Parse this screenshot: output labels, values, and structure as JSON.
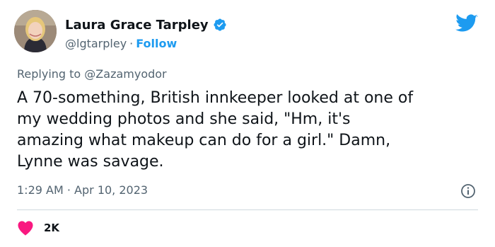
{
  "author": {
    "name": "Laura Grace Tarpley",
    "handle": "@lgtarpley",
    "separator": "·",
    "follow_label": "Follow"
  },
  "tweet": {
    "replying_prefix": "Replying to",
    "replying_to": "@Zazamyodor",
    "text_lines": [
      "A 70-something, British innkeeper looked at one of",
      "my wedding photos and she said, \"Hm, it's",
      "amazing what makeup can do for a girl.\" Damn,",
      "Lynne was savage."
    ],
    "time": "1:29 AM",
    "separator": "·",
    "date": "Apr 10, 2023",
    "like_count": "2K"
  },
  "icons": {
    "brand": "twitter-bird-icon",
    "verified": "verified-badge-icon",
    "info": "info-icon",
    "like": "heart-icon"
  },
  "colors": {
    "brand_blue": "#1d9bf0",
    "like_red": "#f91880",
    "secondary_text": "#536471",
    "divider": "#cfd9de"
  }
}
